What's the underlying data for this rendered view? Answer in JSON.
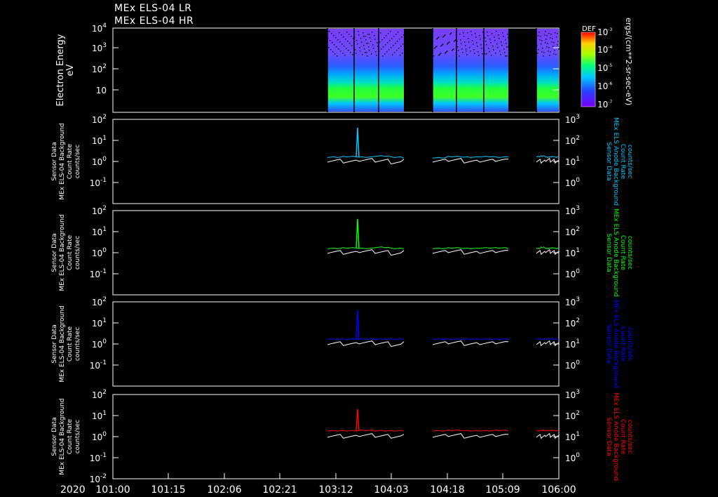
{
  "titles": [
    "MEx ELS-04 LR",
    "MEx ELS-04 HR"
  ],
  "spectrogram": {
    "ylabel": [
      "Electron Energy",
      "eV"
    ],
    "yticks": [
      {
        "base": "10",
        "exp": "4",
        "value": 10000
      },
      {
        "base": "10",
        "exp": "3",
        "value": 1000
      },
      {
        "base": "10",
        "exp": "2",
        "value": 100
      },
      {
        "base": "10",
        "exp": "",
        "value": 10
      }
    ],
    "colorbar": {
      "label": "DEF",
      "ticks": [
        {
          "base": "10",
          "exp": "-3",
          "value": 0.001
        },
        {
          "base": "10",
          "exp": "-4",
          "value": 0.0001
        },
        {
          "base": "10",
          "exp": "-5",
          "value": 1e-05
        },
        {
          "base": "10",
          "exp": "-6",
          "value": 1e-06
        },
        {
          "base": "10",
          "exp": "-7",
          "value": 1e-07
        }
      ],
      "units": "ergs/(cm**2-sr-sec-eV)"
    },
    "data_blocks": [
      {
        "start": "103:06",
        "end": "103:18"
      },
      {
        "start": "103:18",
        "end": "103:30"
      },
      {
        "start": "103:30",
        "end": "103:42"
      },
      {
        "start": "104:12",
        "end": "104:24"
      },
      {
        "start": "104:24",
        "end": "104:36"
      },
      {
        "start": "104:36",
        "end": "104:48"
      },
      {
        "start": "105:24",
        "end": "106:00"
      }
    ]
  },
  "panel_left_label": [
    "Sensor Data",
    "MEx ELS-04 Background",
    "Count Rate",
    "counts/sec"
  ],
  "panel_right_label": [
    "Sensor Data",
    "MEx ELS Anode Background",
    "Count Rate",
    "counts/sec"
  ],
  "left_ticks": [
    {
      "base": "10",
      "exp": "2"
    },
    {
      "base": "10",
      "exp": "1"
    },
    {
      "base": "10",
      "exp": "0"
    },
    {
      "base": "10",
      "exp": "-1"
    }
  ],
  "right_ticks": [
    {
      "base": "10",
      "exp": "3"
    },
    {
      "base": "10",
      "exp": "2"
    },
    {
      "base": "10",
      "exp": "1"
    },
    {
      "base": "10",
      "exp": "0"
    }
  ],
  "bottom_extra_tick": {
    "base": "10",
    "exp": "-2"
  },
  "x_axis": {
    "year": "2020",
    "ticks": [
      "101:00",
      "101:15",
      "102:06",
      "102:21",
      "103:12",
      "104:03",
      "104:18",
      "105:09",
      "106:00"
    ]
  },
  "chart_data": [
    {
      "type": "heatmap",
      "title": "MEx ELS-04 LR / MEx ELS-04 HR",
      "ylabel": "Electron Energy eV",
      "ylim": [
        2,
        10000
      ],
      "yscale": "log",
      "colorbar_range": [
        1e-07,
        0.001
      ],
      "colorbar_label": "DEF",
      "colorbar_units": "ergs/(cm**2-sr-sec-eV)",
      "x_range": [
        "101:00",
        "106:00"
      ],
      "x_ticks": [
        "101:00",
        "101:15",
        "102:06",
        "102:21",
        "103:12",
        "104:03",
        "104:18",
        "105:09",
        "106:00"
      ]
    },
    {
      "type": "line",
      "ylabel": "Sensor Data MEx ELS-04 Background Count Rate counts/sec",
      "ylim": [
        0.01,
        100
      ],
      "yscale": "log",
      "right_ylabel": "Sensor Data MEx ELS Anode Background Count Rate counts/sec",
      "right_ylim": [
        0.1,
        1000
      ],
      "color": "#00c8ff",
      "series": [
        {
          "values": [
            1.6,
            1.7,
            1.6,
            1.8,
            40.0,
            1.5,
            1.7,
            1.6,
            1.7,
            1.6,
            1.7,
            1.8,
            1.6,
            1.7,
            1.6
          ]
        },
        {
          "values": [
            1.1,
            1.0,
            1.2,
            1.1,
            0.9,
            1.1,
            1.2,
            1.0,
            1.1,
            1.2,
            1.1,
            1.0,
            1.2,
            1.1,
            1.0
          ]
        }
      ]
    },
    {
      "type": "line",
      "ylabel": "Sensor Data MEx ELS-04 Background Count Rate counts/sec",
      "ylim": [
        0.01,
        100
      ],
      "yscale": "log",
      "right_ylabel": "Sensor Data MEx ELS Anode Background Count Rate counts/sec",
      "right_ylim": [
        0.1,
        1000
      ],
      "color": "#00ff00",
      "series": [
        {
          "values": [
            1.6,
            1.7,
            1.6,
            1.8,
            40.0,
            1.6,
            1.7,
            1.6,
            1.7,
            1.7,
            1.6,
            1.8,
            1.6,
            1.7,
            1.6
          ]
        },
        {
          "values": [
            1.1,
            1.0,
            1.2,
            1.1,
            0.9,
            1.1,
            1.2,
            1.0,
            1.1,
            1.2,
            1.1,
            1.0,
            1.2,
            1.1,
            1.0
          ]
        }
      ]
    },
    {
      "type": "line",
      "ylabel": "Sensor Data MEx ELS-04 Background Count Rate counts/sec",
      "ylim": [
        0.01,
        100
      ],
      "yscale": "log",
      "right_ylabel": "Sensor Data MEx ELS Anode Background Count Rate counts/sec",
      "right_ylim": [
        0.1,
        1000
      ],
      "color": "#0000ff",
      "series": [
        {
          "values": [
            1.7,
            1.7,
            1.7,
            1.7,
            40.0,
            1.7,
            1.7,
            1.7,
            1.7,
            1.7,
            1.7,
            1.7,
            1.7,
            1.7,
            1.7
          ]
        },
        {
          "values": [
            1.1,
            1.0,
            1.2,
            1.1,
            0.9,
            1.1,
            1.2,
            1.0,
            1.1,
            1.2,
            1.1,
            1.0,
            1.2,
            1.1,
            1.0
          ]
        }
      ]
    },
    {
      "type": "line",
      "ylabel": "Sensor Data MEx ELS-04 Background Count Rate counts/sec",
      "ylim": [
        0.01,
        100
      ],
      "yscale": "log",
      "right_ylabel": "Sensor Data MEx ELS Anode Background Count Rate counts/sec",
      "right_ylim": [
        0.1,
        1000
      ],
      "color": "#ff0000",
      "series": [
        {
          "values": [
            1.9,
            1.9,
            2.0,
            1.9,
            20.0,
            1.9,
            2.0,
            1.9,
            1.9,
            2.0,
            1.9,
            2.0,
            1.9,
            2.0,
            1.9
          ]
        },
        {
          "values": [
            1.1,
            1.0,
            1.2,
            1.1,
            1.0,
            1.1,
            1.2,
            1.0,
            1.1,
            1.2,
            1.1,
            1.0,
            1.2,
            1.1,
            1.0
          ]
        }
      ]
    }
  ]
}
